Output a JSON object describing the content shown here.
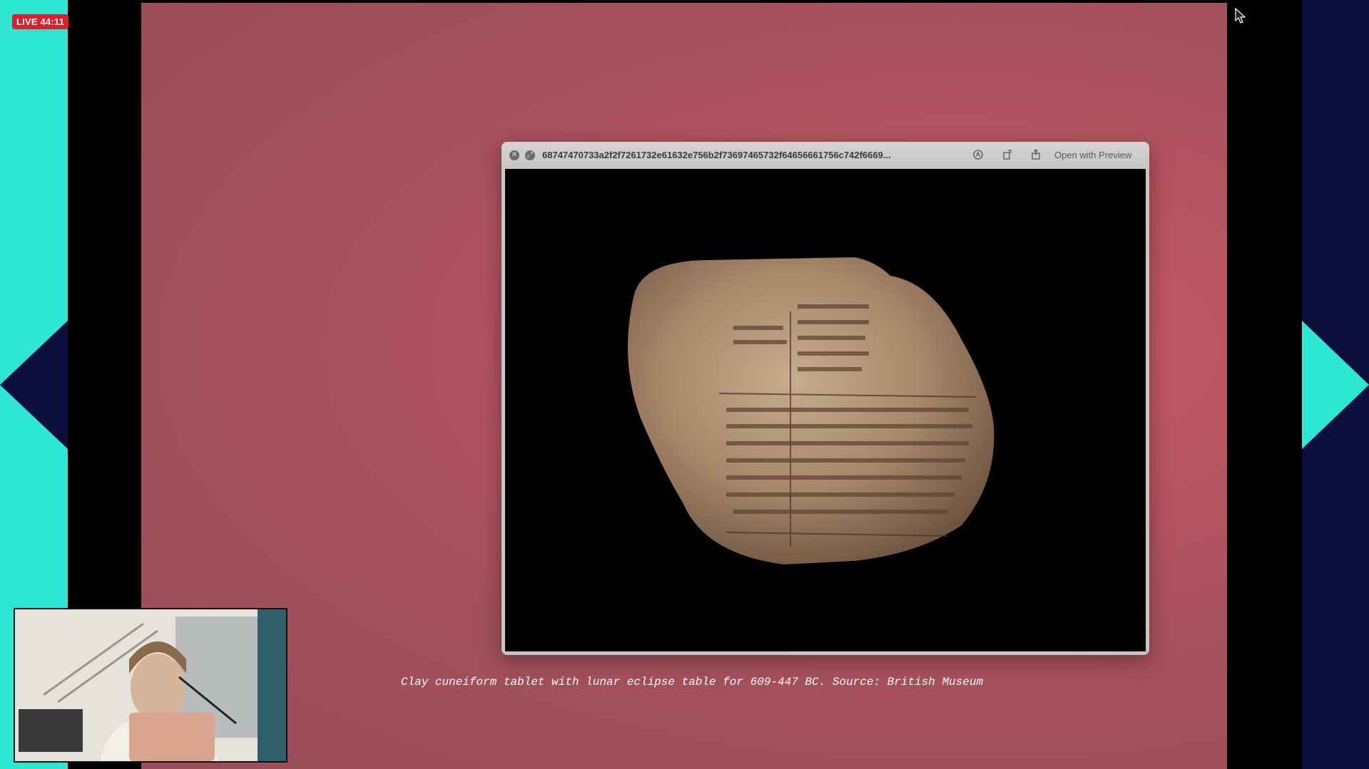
{
  "live_badge": "LIVE 44:11",
  "quicklook": {
    "filename": "68747470733a2f2f7261732e61632e756b2f73697465732f64656661756c742f6669...",
    "open_with_label": "Open with Preview"
  },
  "caption": "Clay cuneiform tablet with lunar eclipse table for 609-447 BC. Source: British Museum",
  "colors": {
    "slide_bg": "#b65461",
    "teal_accent": "#2ee6d4",
    "navy_accent": "#0a0f3c",
    "live_red": "#e01e2b"
  }
}
